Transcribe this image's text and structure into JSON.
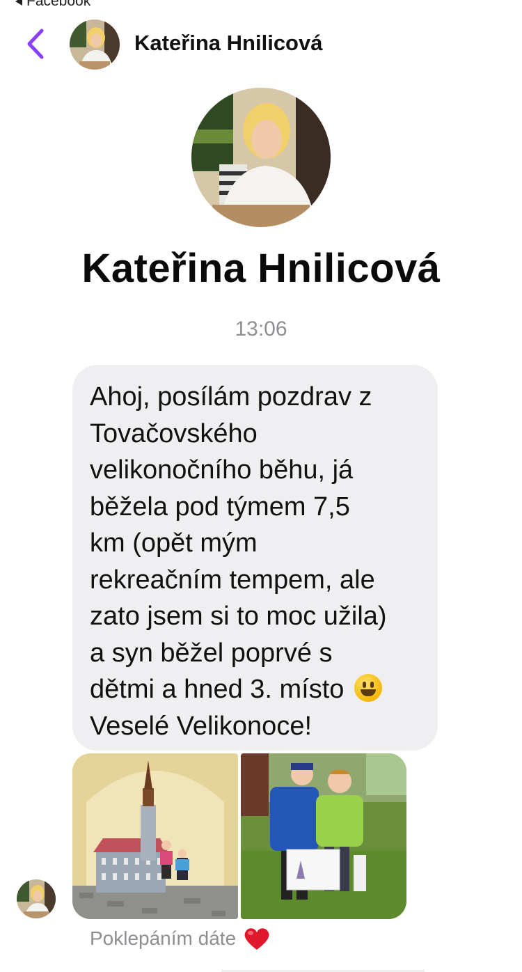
{
  "status_bar": {
    "back_label": "Facebook"
  },
  "header": {
    "name": "Kateřina Hnilicová"
  },
  "profile": {
    "name": "Kateřina Hnilicová"
  },
  "conversation": {
    "timestamp": "13:06",
    "message": {
      "text": "Ahoj, posílám pozdrav z\nTovačovského\nvelikonočního běhu, já\nběžela pod týmem 7,5\nkm (opět mým\nrekreačním tempem, ale\nzato jsem si to moc užila)\na syn běžel poprvé s\ndětmi a hned 3. místo",
      "emoji": "grinning-face",
      "text_after": "Veselé Velikonoce!"
    },
    "photos": [
      {
        "icon": "photo-town-model"
      },
      {
        "icon": "photo-children-with-diploma"
      }
    ],
    "reaction_hint": {
      "text": "Poklepáním dáte",
      "emoji": "heart"
    }
  },
  "colors": {
    "accent": "#8a3ffc",
    "bubble": "#efeff1",
    "meta_text": "#8e8e93",
    "heart": "#e0182b"
  }
}
